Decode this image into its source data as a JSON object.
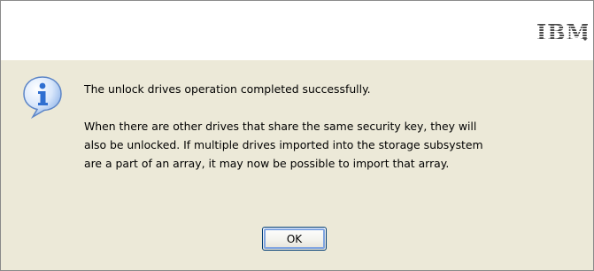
{
  "brand": {
    "logo_text": "IBM"
  },
  "dialog": {
    "icon": "information-icon",
    "message_primary": "The unlock drives operation completed successfully.",
    "message_secondary_lines": [
      "When there are other drives that share the same security key, they will",
      "also be unlocked. If multiple drives imported into the storage subsystem",
      "are a part of an array, it may now be possible to import that array."
    ],
    "ok_label": "OK"
  },
  "colors": {
    "dialog_background": "#ece9d8",
    "header_background": "#ffffff",
    "button_focus_border": "#7fa4e0",
    "button_border": "#003c74",
    "icon_blue": "#2f6fd1"
  }
}
